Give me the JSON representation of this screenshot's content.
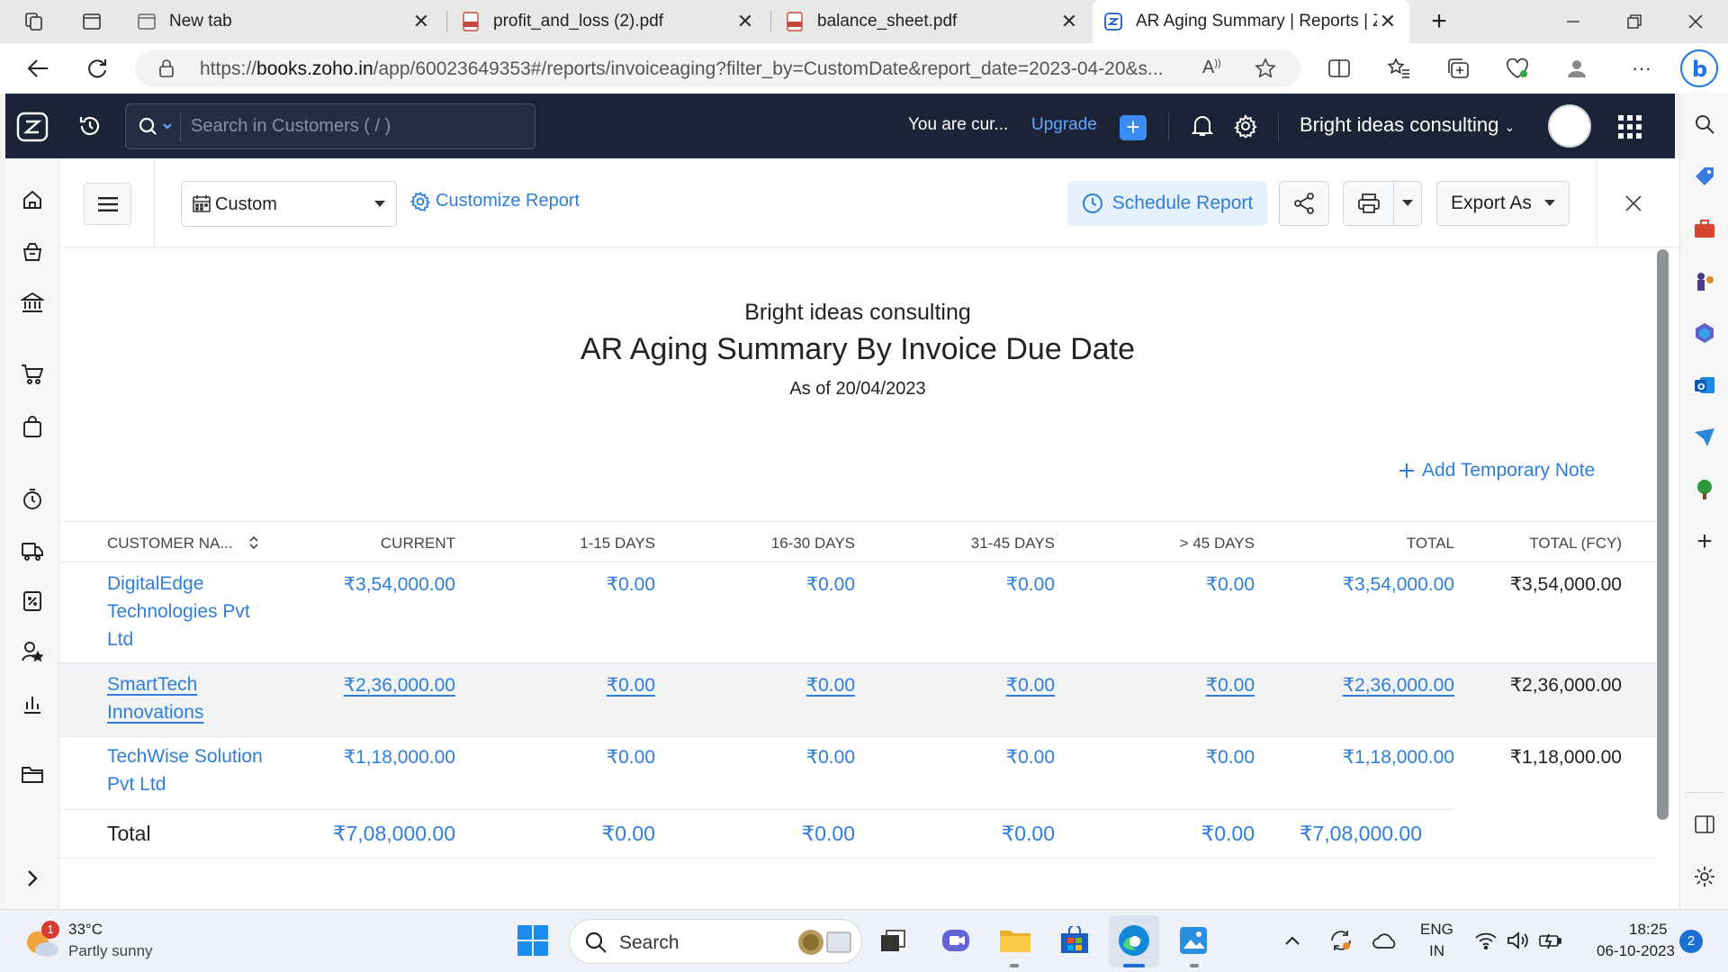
{
  "browser": {
    "tabs": [
      {
        "title": "New tab",
        "close": "✕"
      },
      {
        "title": "profit_and_loss (2).pdf",
        "close": "✕"
      },
      {
        "title": "balance_sheet.pdf",
        "close": "✕"
      },
      {
        "title": "AR Aging Summary | Reports | Zo",
        "close": "✕"
      }
    ],
    "new_tab": "+",
    "url_prefix": "https://",
    "url_host": "books.zoho.in",
    "url_path": "/app/60023649353#/reports/invoiceaging?filter_by=CustomDate&report_date=2023-04-20&s..."
  },
  "app": {
    "search_placeholder": "Search in Customers ( / )",
    "trial_text": "You are cur...",
    "upgrade": "Upgrade",
    "org_name": "Bright ideas consulting"
  },
  "toolbar": {
    "period": "Custom",
    "customize": "Customize Report",
    "schedule": "Schedule Report",
    "export": "Export As"
  },
  "report": {
    "org": "Bright ideas consulting",
    "title": "AR Aging Summary By Invoice Due Date",
    "as_of": "As of 20/04/2023",
    "add_note": "Add Temporary Note",
    "columns": [
      "CUSTOMER NA...",
      "CURRENT",
      "1-15 DAYS",
      "16-30 DAYS",
      "31-45 DAYS",
      "> 45 DAYS",
      "TOTAL",
      "TOTAL (FCY)"
    ],
    "rows": [
      {
        "customer": "DigitalEdge Technologies Pvt Ltd",
        "current": "₹3,54,000.00",
        "d1_15": "₹0.00",
        "d16_30": "₹0.00",
        "d31_45": "₹0.00",
        "d45": "₹0.00",
        "total": "₹3,54,000.00",
        "total_fcy": "₹3,54,000.00"
      },
      {
        "customer": "SmartTech Innovations",
        "current": "₹2,36,000.00",
        "d1_15": "₹0.00",
        "d16_30": "₹0.00",
        "d31_45": "₹0.00",
        "d45": "₹0.00",
        "total": "₹2,36,000.00",
        "total_fcy": "₹2,36,000.00"
      },
      {
        "customer": "TechWise Solution Pvt Ltd",
        "current": "₹1,18,000.00",
        "d1_15": "₹0.00",
        "d16_30": "₹0.00",
        "d31_45": "₹0.00",
        "d45": "₹0.00",
        "total": "₹1,18,000.00",
        "total_fcy": "₹1,18,000.00"
      }
    ],
    "totals": {
      "label": "Total",
      "current": "₹7,08,000.00",
      "d1_15": "₹0.00",
      "d16_30": "₹0.00",
      "d31_45": "₹0.00",
      "d45": "₹0.00",
      "total": "₹7,08,000.00"
    }
  },
  "taskbar": {
    "weather_badge": "1",
    "temp": "33°C",
    "condition": "Partly sunny",
    "search": "Search",
    "lang1": "ENG",
    "lang2": "IN",
    "time": "18:25",
    "date": "06-10-2023",
    "notif_count": "2"
  },
  "colors": {
    "accent": "#2f7ed8",
    "navbar": "#1d2336",
    "hover_row": "#f2f3f5"
  }
}
